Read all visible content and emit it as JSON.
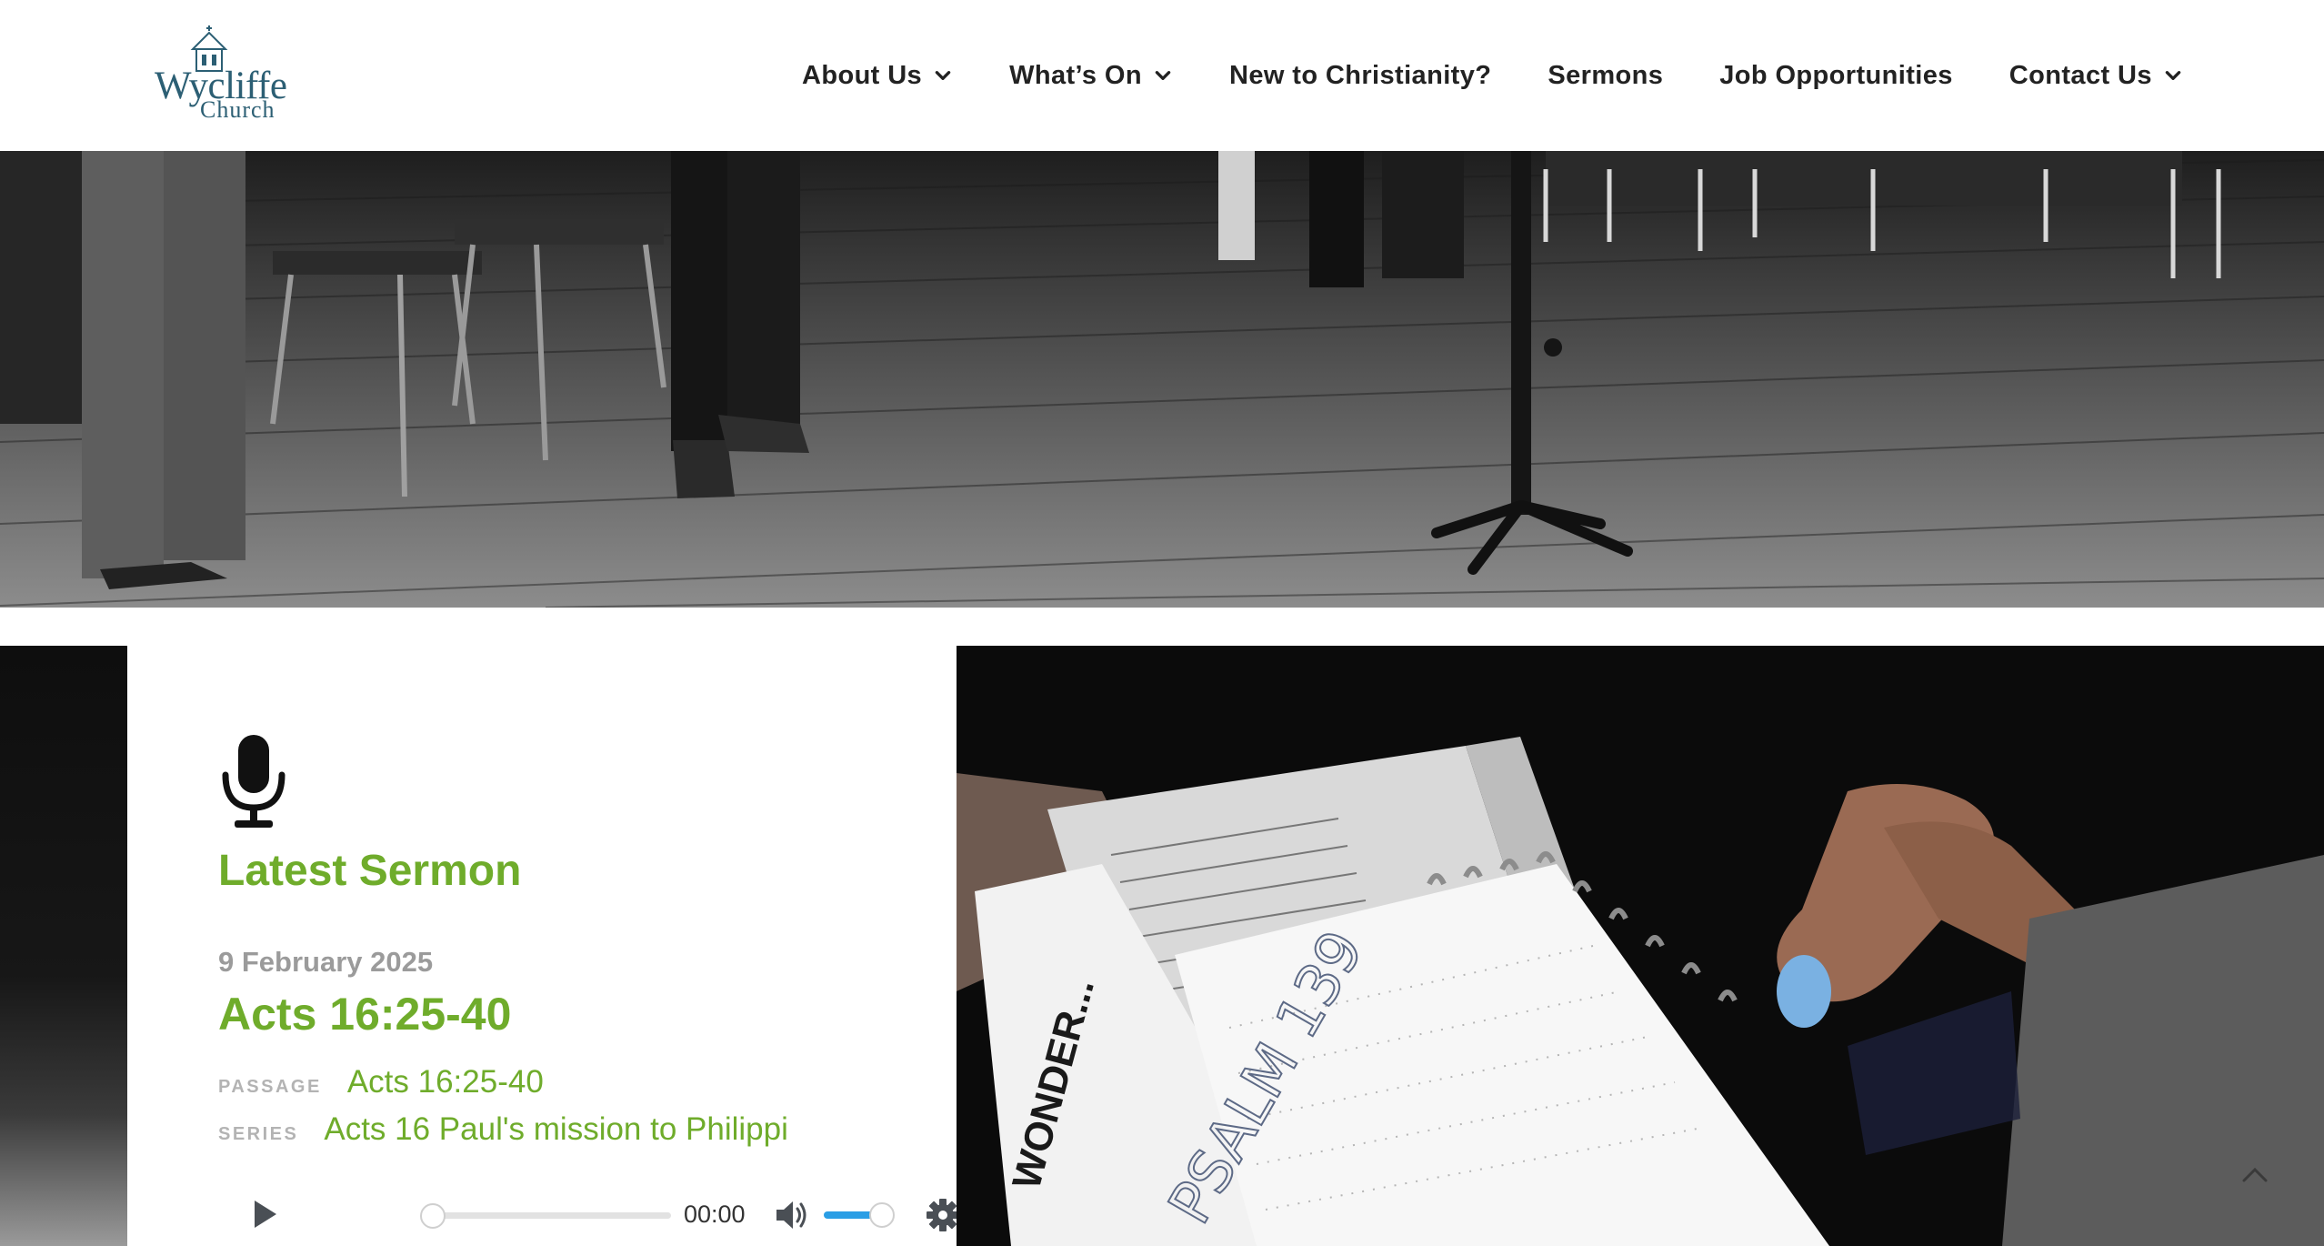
{
  "header": {
    "logo": {
      "line1": "Wycliffe",
      "line2": "Church"
    },
    "nav": [
      {
        "label": "About Us",
        "dropdown": true
      },
      {
        "label": "What’s On",
        "dropdown": true
      },
      {
        "label": "New to Christianity?",
        "dropdown": false
      },
      {
        "label": "Sermons",
        "dropdown": false
      },
      {
        "label": "Job Opportunities",
        "dropdown": false
      },
      {
        "label": "Contact Us",
        "dropdown": true
      }
    ]
  },
  "sermon": {
    "icon": "microphone-icon",
    "heading": "Latest Sermon",
    "date": "9 February 2025",
    "title": "Acts 16:25-40",
    "passage_label": "PASSAGE",
    "passage": "Acts 16:25-40",
    "series_label": "SERIES",
    "series": "Acts 16 Paul's mission to Philippi",
    "player": {
      "time": "00:00",
      "progress": 0,
      "volume": 1.0
    }
  },
  "colors": {
    "accent_green": "#6fac2b",
    "nav_text": "#222222",
    "muted_gray": "#9b9b9b",
    "logo_blue": "#2c5f74",
    "volume_blue": "#2a9ee5"
  }
}
